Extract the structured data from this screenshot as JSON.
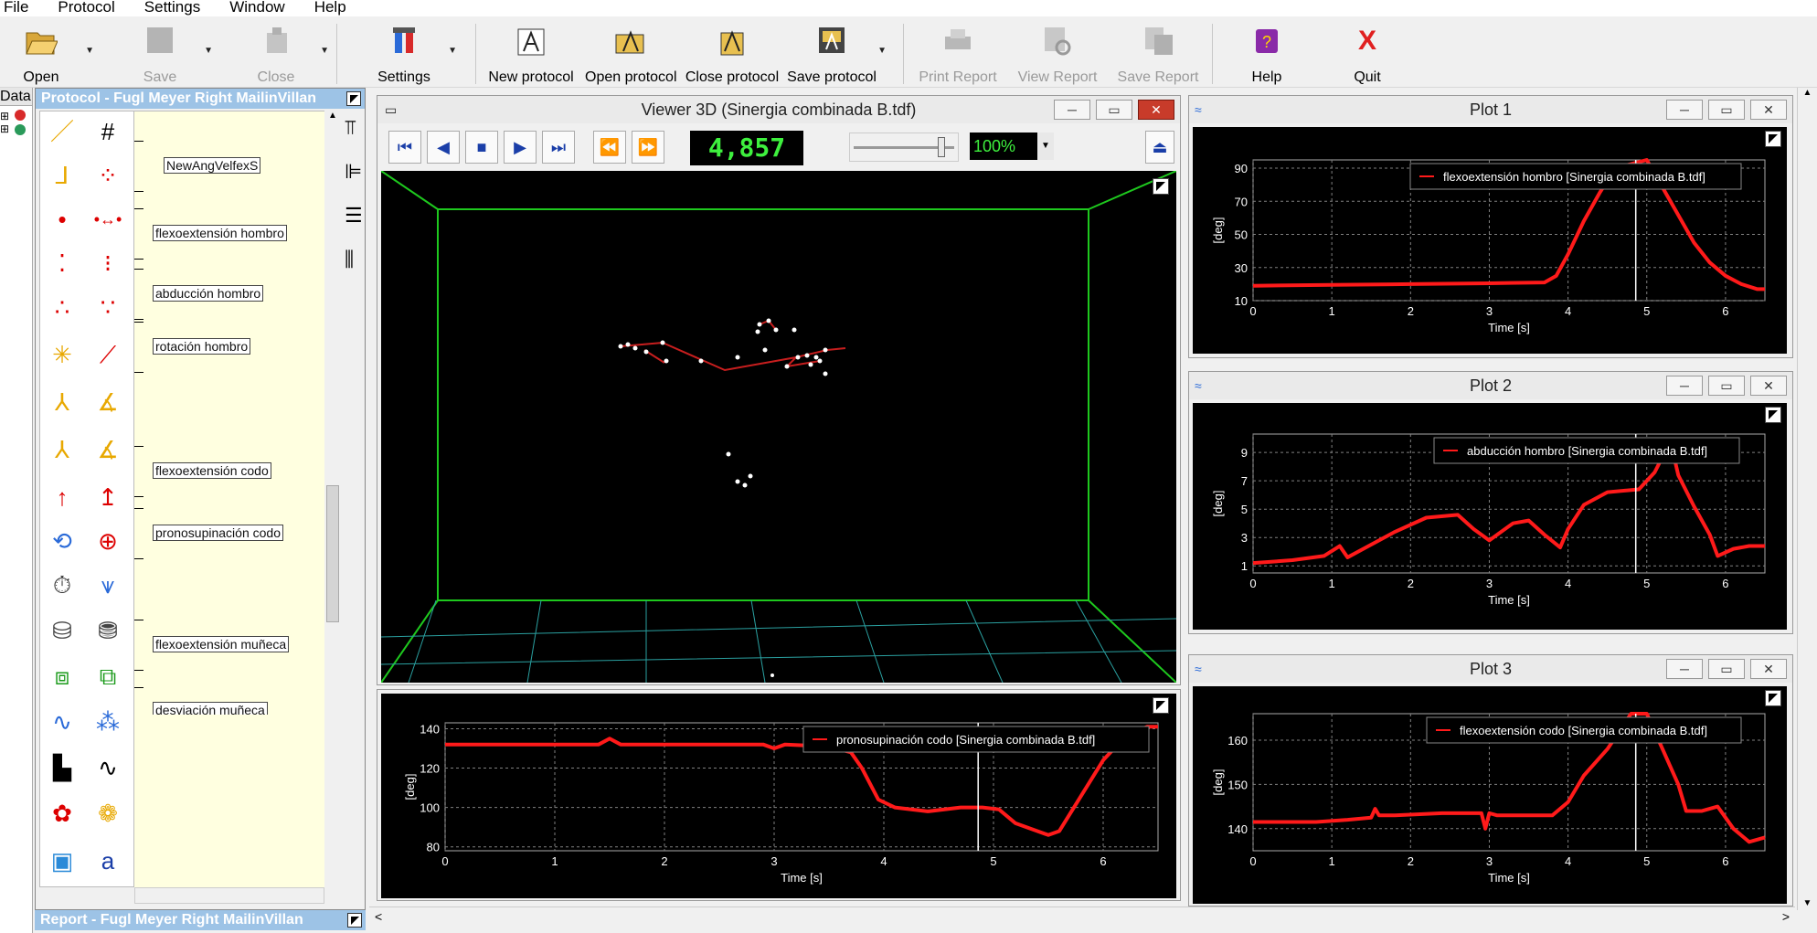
{
  "menu": [
    "File",
    "Protocol",
    "Settings",
    "Window",
    "Help"
  ],
  "toolbar": {
    "open": "Open",
    "save": "Save",
    "close": "Close",
    "settings": "Settings",
    "new_protocol": "New protocol",
    "open_protocol": "Open protocol",
    "close_protocol": "Close protocol",
    "save_protocol": "Save protocol",
    "print_report": "Print Report",
    "view_report": "View Report",
    "save_report": "Save Report",
    "help": "Help",
    "quit": "Quit",
    "quit_symbol": "X"
  },
  "data_pane": {
    "title": "Data"
  },
  "protocol_pane": {
    "title": "Protocol - Fugl Meyer Right MailinVillan",
    "nodes": [
      "NewAngVelfexS",
      "flexoextensión hombro",
      "abducción hombro",
      "rotación hombro",
      "flexoextensión codo",
      "pronosupinación codo",
      "flexoextensión muñeca",
      "desviación muñeca"
    ]
  },
  "report_pane": {
    "title": "Report - Fugl Meyer Right MailinVillan"
  },
  "viewer": {
    "title": "Viewer 3D (Sinergia combinada B.tdf)",
    "frame": "4,857",
    "zoom": "100%"
  },
  "colors": {
    "trace": "#ff1a1a",
    "grid": "#808080",
    "axes_box": "#1ec81e",
    "floor": "#2aa0a0"
  },
  "plots": [
    {
      "title": "Plot 1",
      "legend": "flexoextensión hombro [Sinergia combinada B.tdf]",
      "ylabel": "[deg]",
      "xlabel": "Time [s]"
    },
    {
      "title": "Plot 2",
      "legend": "abducción hombro [Sinergia combinada B.tdf]",
      "ylabel": "[deg]",
      "xlabel": "Time [s]"
    },
    {
      "title": "Plot 3",
      "legend": "flexoextensión codo [Sinergia combinada B.tdf]",
      "ylabel": "[deg]",
      "xlabel": "Time [s]"
    }
  ],
  "bottom_plot": {
    "legend": "pronosupinación codo [Sinergia combinada B.tdf]",
    "ylabel": "[deg]",
    "xlabel": "Time [s]"
  },
  "chart_data": [
    {
      "type": "line",
      "legend": "flexoextensión hombro [Sinergia combinada B.tdf]",
      "xlabel": "Time [s]",
      "ylabel": "[deg]",
      "xlim": [
        0,
        6.5
      ],
      "ylim": [
        10,
        95
      ],
      "xticks": [
        0,
        1,
        2,
        3,
        4,
        5,
        6
      ],
      "yticks": [
        10,
        30,
        50,
        70,
        90
      ],
      "cursor_x": 4.86,
      "x": [
        0,
        1,
        2,
        3,
        3.7,
        3.85,
        4.0,
        4.2,
        4.4,
        4.6,
        5.0,
        5.3,
        5.6,
        5.8,
        6.0,
        6.2,
        6.4,
        6.5
      ],
      "y": [
        19,
        19.5,
        20,
        20.5,
        21,
        25,
        38,
        58,
        75,
        90,
        95,
        70,
        45,
        33,
        25,
        20,
        17,
        17
      ]
    },
    {
      "type": "line",
      "legend": "abducción hombro [Sinergia combinada B.tdf]",
      "xlabel": "Time [s]",
      "ylabel": "[deg]",
      "xlim": [
        0,
        6.5
      ],
      "ylim": [
        0.5,
        10.3
      ],
      "xticks": [
        0,
        1,
        2,
        3,
        4,
        5,
        6
      ],
      "yticks": [
        1,
        3,
        5,
        7,
        9
      ],
      "cursor_x": 4.86,
      "x": [
        0,
        0.5,
        0.9,
        1.1,
        1.2,
        1.4,
        1.8,
        2.2,
        2.6,
        2.8,
        3.0,
        3.3,
        3.5,
        3.7,
        3.9,
        4.0,
        4.2,
        4.5,
        4.9,
        5.1,
        5.3,
        5.4,
        5.6,
        5.8,
        5.9,
        6.1,
        6.3,
        6.5
      ],
      "y": [
        1.2,
        1.4,
        1.7,
        2.4,
        1.6,
        2.2,
        3.4,
        4.4,
        4.6,
        3.6,
        2.8,
        4.0,
        4.2,
        3.2,
        2.3,
        3.6,
        5.3,
        6.2,
        6.4,
        7.6,
        9.8,
        7.4,
        5.2,
        3.2,
        1.7,
        2.2,
        2.4,
        2.4
      ]
    },
    {
      "type": "line",
      "legend": "flexoextensión codo [Sinergia combinada B.tdf]",
      "xlabel": "Time [s]",
      "ylabel": "[deg]",
      "xlim": [
        0,
        6.5
      ],
      "ylim": [
        135,
        166
      ],
      "xticks": [
        0,
        1,
        2,
        3,
        4,
        5,
        6
      ],
      "yticks": [
        140,
        150,
        160
      ],
      "cursor_x": 4.86,
      "x": [
        0,
        0.8,
        1.2,
        1.5,
        1.55,
        1.6,
        1.8,
        2.4,
        2.9,
        2.95,
        3.0,
        3.1,
        3.5,
        3.8,
        4.0,
        4.2,
        4.5,
        4.8,
        5.0,
        5.2,
        5.4,
        5.5,
        5.7,
        5.9,
        6.1,
        6.3,
        6.5
      ],
      "y": [
        141.5,
        141.5,
        142,
        142.5,
        144.5,
        143,
        143,
        143.5,
        143.5,
        140,
        143.5,
        143,
        143,
        143,
        146,
        152,
        158,
        166,
        166,
        158,
        150,
        144,
        144,
        145,
        140,
        137,
        138
      ]
    },
    {
      "type": "line",
      "legend": "pronosupinación codo [Sinergia combinada B.tdf]",
      "xlabel": "Time [s]",
      "ylabel": "[deg]",
      "xlim": [
        0,
        6.5
      ],
      "ylim": [
        78,
        143
      ],
      "xticks": [
        0,
        1,
        2,
        3,
        4,
        5,
        6
      ],
      "yticks": [
        80,
        100,
        120,
        140
      ],
      "cursor_x": 4.86,
      "x": [
        0,
        1,
        1.4,
        1.5,
        1.6,
        2,
        2.9,
        3.0,
        3.1,
        3.5,
        3.7,
        3.8,
        3.95,
        4.1,
        4.4,
        4.7,
        4.9,
        5.05,
        5.2,
        5.5,
        5.6,
        5.8,
        6.0,
        6.2,
        6.4,
        6.5
      ],
      "y": [
        132,
        132,
        132,
        135,
        132,
        132,
        132,
        130,
        132,
        131,
        128,
        120,
        104,
        100,
        98,
        100,
        100,
        99,
        92,
        86,
        88,
        106,
        124,
        136,
        141,
        141
      ]
    }
  ]
}
